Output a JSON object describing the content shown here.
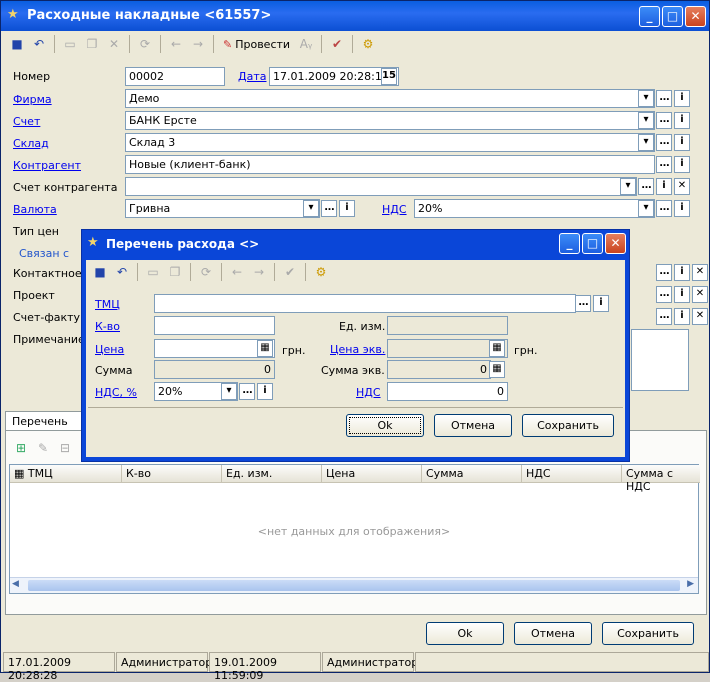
{
  "main_window": {
    "title": "Расходные накладные <61557>",
    "toolbar": {
      "post_label": "Провести"
    },
    "fields": {
      "number_label": "Номер",
      "number_value": "00002",
      "date_label": "Дата",
      "date_value": "17.01.2009 20:28:11",
      "firm_label": "Фирма",
      "firm_value": "Демо",
      "account_label": "Счет",
      "account_value": "БАНК Ерсте",
      "warehouse_label": "Склад",
      "warehouse_value": "Склад 3",
      "contractor_label": "Контрагент",
      "contractor_value": "Новые (клиент-банк)",
      "contractor_account_label": "Счет контрагента",
      "contractor_account_value": "",
      "currency_label": "Валюта",
      "currency_value": "Гривна",
      "vat_label": "НДС",
      "vat_value": "20%",
      "price_type_label": "Тип цен",
      "linked_label": "Связан с",
      "contact_label": "Контактное л",
      "project_label": "Проект",
      "invoice_label": "Счет-фактура",
      "note_label": "Примечание"
    },
    "tab_label": "Перечень расх",
    "grid": {
      "columns": [
        "ТМЦ",
        "К-во",
        "Ед. изм.",
        "Цена",
        "Сумма",
        "НДС",
        "Сумма с НДС"
      ],
      "empty_text": "<нет данных для отображения>"
    },
    "buttons": {
      "ok": "Ok",
      "cancel": "Отмена",
      "save": "Сохранить"
    },
    "status": {
      "created_date": "17.01.2009 20:28:28",
      "created_user": "Администратор",
      "modified_date": "19.01.2009 11:59:09",
      "modified_user": "Администратор"
    }
  },
  "dialog": {
    "title": "Перечень расхода <>",
    "fields": {
      "item_label": "ТМЦ",
      "item_value": "",
      "qty_label": "К-во",
      "qty_value": "",
      "unit_label": "Ед. изм.",
      "unit_value": "",
      "price_label": "Цена",
      "price_value": "",
      "price_currency": "грн.",
      "price_eq_label": "Цена экв.",
      "price_eq_value": "",
      "price_eq_currency": "грн.",
      "sum_label": "Сумма",
      "sum_value": "0",
      "sum_eq_label": "Сумма экв.",
      "sum_eq_value": "0",
      "vat_pct_label": "НДС, %",
      "vat_pct_value": "20%",
      "vat_label": "НДС",
      "vat_value": "0"
    },
    "buttons": {
      "ok": "Ok",
      "cancel": "Отмена",
      "save": "Сохранить"
    }
  }
}
